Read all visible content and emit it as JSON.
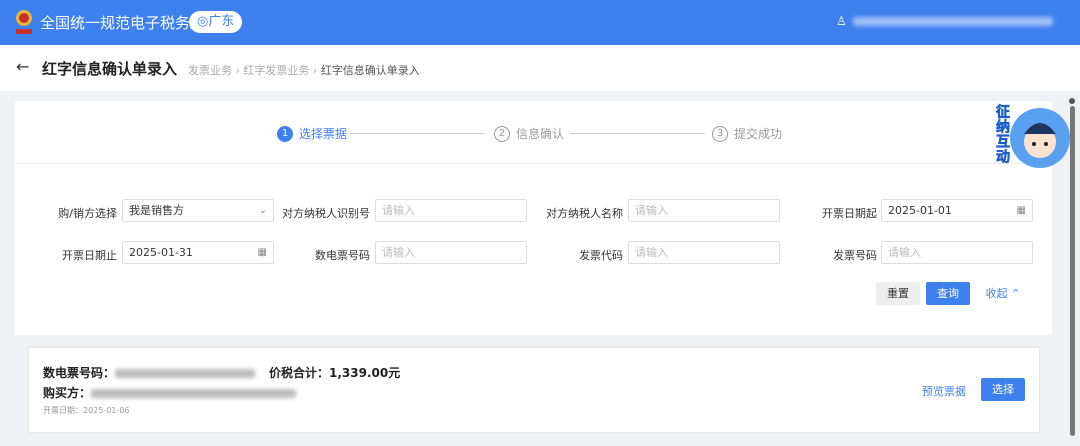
{
  "header": {
    "title": "全国统一规范电子税务局",
    "region": "广东",
    "user": "用户名已模糊"
  },
  "page": {
    "title": "红字信息确认单录入",
    "breadcrumb": [
      "发票业务",
      "红字发票业务",
      "红字信息确认单录入"
    ]
  },
  "steps": [
    {
      "n": "1",
      "label": "选择票据"
    },
    {
      "n": "2",
      "label": "信息确认"
    },
    {
      "n": "3",
      "label": "提交成功"
    }
  ],
  "form": {
    "buyer_seller": {
      "label": "购/销方选择",
      "value": "我是销售方"
    },
    "counterparty_id": {
      "label": "对方纳税人识别号",
      "placeholder": "请输入"
    },
    "counterparty_name": {
      "label": "对方纳税人名称",
      "placeholder": "请输入"
    },
    "date_start": {
      "label": "开票日期起",
      "value": "2025-01-01"
    },
    "date_end": {
      "label": "开票日期止",
      "value": "2025-01-31"
    },
    "einvoice_no": {
      "label": "数电票号码",
      "placeholder": "请输入"
    },
    "invoice_code": {
      "label": "发票代码",
      "placeholder": "请输入"
    },
    "invoice_no": {
      "label": "发票号码",
      "placeholder": "请输入"
    },
    "reset": "重置",
    "query": "查询",
    "collapse": "收起"
  },
  "mascot": {
    "text": "征纳互动"
  },
  "result": {
    "no_label": "数电票号码：",
    "total_label": "价税合计：",
    "total": "1,339.00元",
    "buyer_label": "购买方：",
    "date_label": "开票日期：",
    "date": "2025-01-06",
    "preview": "预览票据",
    "select": "选择"
  }
}
